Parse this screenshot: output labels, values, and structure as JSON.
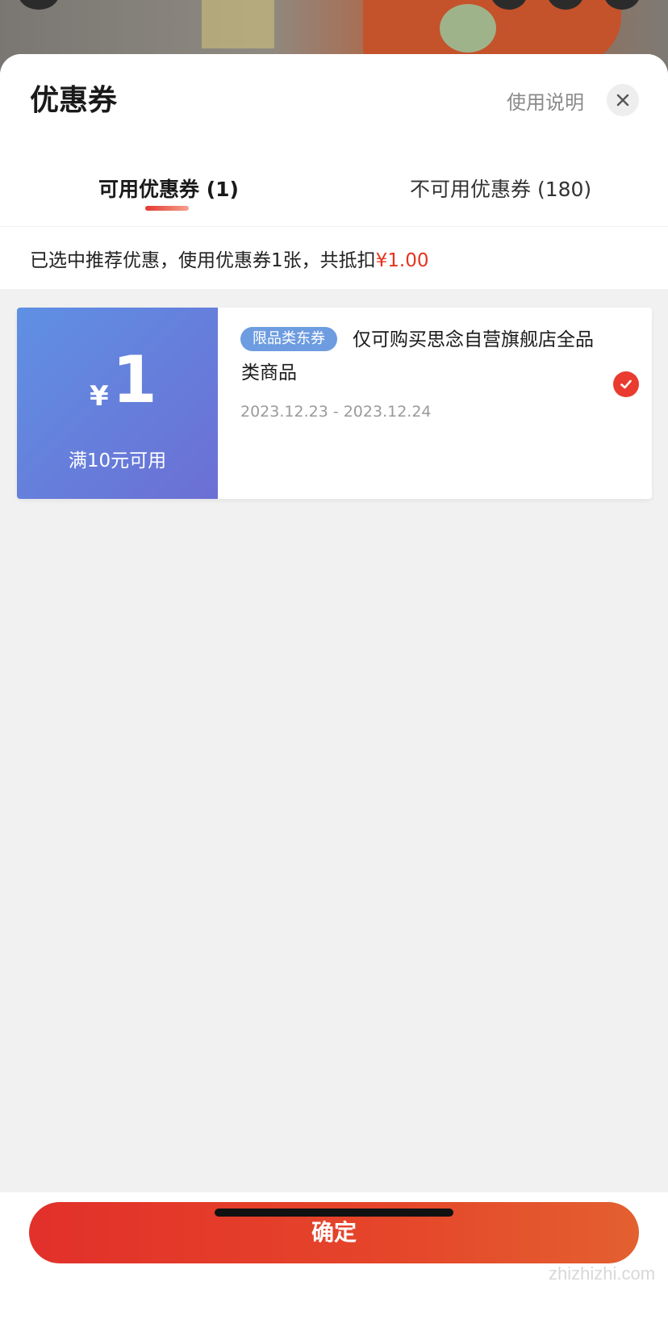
{
  "sheet": {
    "title": "优惠券",
    "help_link": "使用说明",
    "close_icon": "close-icon"
  },
  "tabs": [
    {
      "label": "可用优惠券 (1)",
      "active": true
    },
    {
      "label": "不可用优惠券 (180)",
      "active": false
    }
  ],
  "notice": {
    "text": "已选中推荐优惠，使用优惠券1张，共抵扣",
    "amount": "¥1.00"
  },
  "coupons": [
    {
      "currency": "¥",
      "amount": "1",
      "condition": "满10元可用",
      "badge": "限品类东券",
      "description": "仅可购买思念自营旗舰店全品类商品",
      "dates": "2023.12.23 - 2023.12.24",
      "selected": true,
      "selected_icon": "check-circle-icon"
    }
  ],
  "footer": {
    "confirm_label": "确定"
  },
  "watermark": "zhizhizhi.com",
  "colors": {
    "accent": "#e6331f",
    "coupon_blue": "#6c7ad6",
    "badge_blue": "#6d9ce0"
  }
}
